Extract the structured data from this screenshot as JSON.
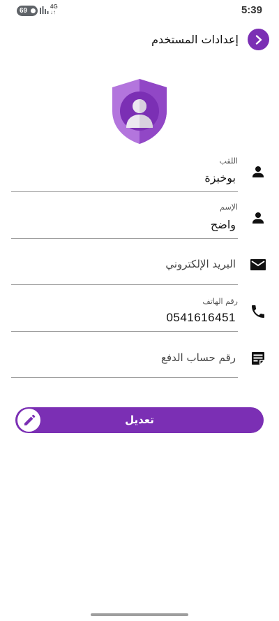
{
  "status_bar": {
    "time": "5:39",
    "battery": "69",
    "network": "4G"
  },
  "header": {
    "title": "إعدادات المستخدم"
  },
  "fields": {
    "title": {
      "label": "اللقب",
      "value": "بوخبزة"
    },
    "name": {
      "label": "الإسم",
      "value": "واضح"
    },
    "email": {
      "placeholder": "البريد الإلكتروني"
    },
    "phone": {
      "label": "رقم الهاتف",
      "value": "0541616451"
    },
    "payment": {
      "placeholder": "رقم حساب الدفع"
    }
  },
  "edit_button": {
    "label": "تعديل"
  },
  "colors": {
    "accent": "#7b2fb4",
    "shield_light": "#b375dd",
    "shield_dark": "#9147c6"
  }
}
